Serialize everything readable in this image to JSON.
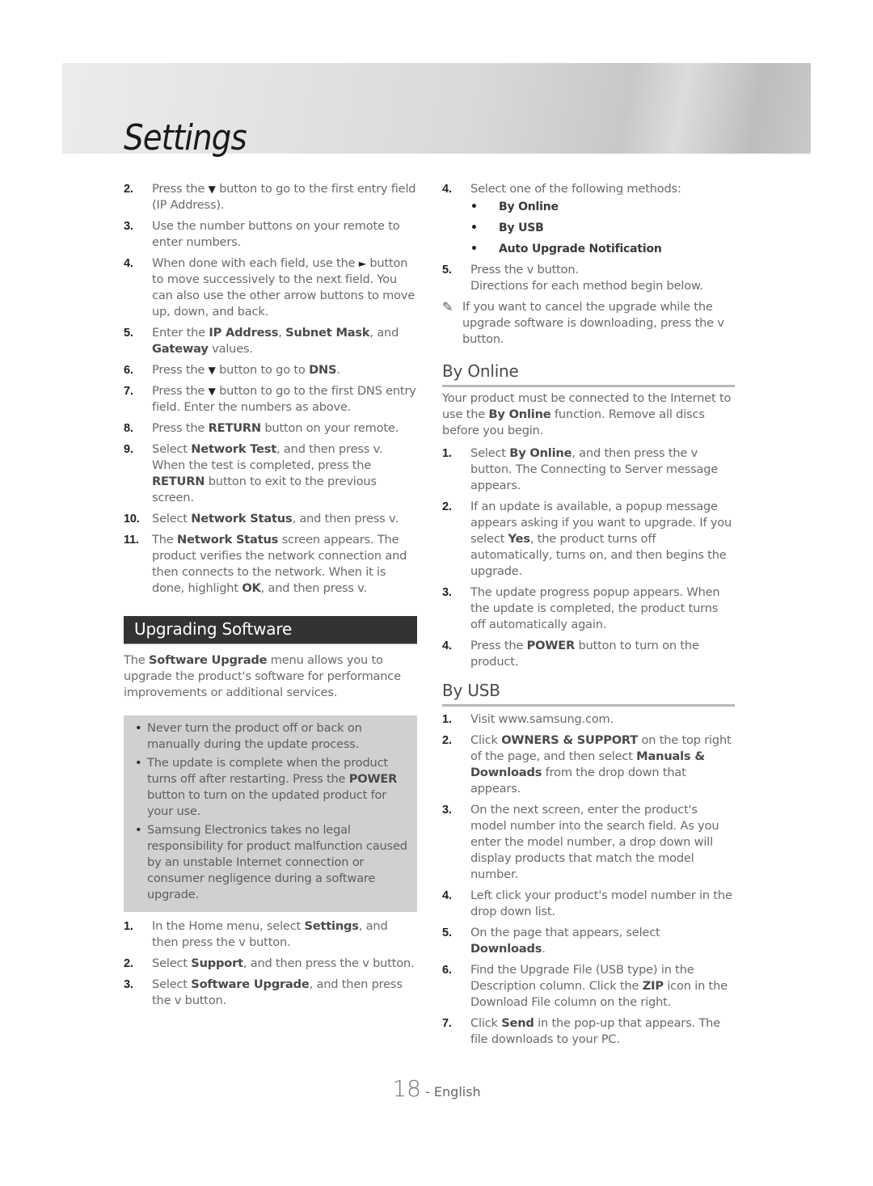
{
  "header": {
    "title": "Settings"
  },
  "left": {
    "steps_top": [
      {
        "num": "2.",
        "parts": [
          {
            "t": "Press the "
          },
          {
            "t": "▼",
            "icon": "down-arrow-icon"
          },
          {
            "t": " button to go to the first entry field (IP Address)."
          }
        ]
      },
      {
        "num": "3.",
        "parts": [
          {
            "t": "Use the number buttons on your remote to enter numbers."
          }
        ]
      },
      {
        "num": "4.",
        "parts": [
          {
            "t": "When done with each field, use the "
          },
          {
            "t": "►",
            "icon": "right-arrow-icon"
          },
          {
            "t": " button to move successively to the next field. You can also use the other arrow buttons to move up, down, and back."
          }
        ]
      },
      {
        "num": "5.",
        "parts": [
          {
            "t": "Enter the "
          },
          {
            "t": "IP Address",
            "b": true
          },
          {
            "t": ", "
          },
          {
            "t": "Subnet Mask",
            "b": true
          },
          {
            "t": ", and "
          },
          {
            "t": "Gateway",
            "b": true
          },
          {
            "t": " values."
          }
        ]
      },
      {
        "num": "6.",
        "parts": [
          {
            "t": "Press the "
          },
          {
            "t": "▼",
            "icon": "down-arrow-icon"
          },
          {
            "t": " button to go to "
          },
          {
            "t": "DNS",
            "b": true
          },
          {
            "t": "."
          }
        ]
      },
      {
        "num": "7.",
        "parts": [
          {
            "t": "Press the "
          },
          {
            "t": "▼",
            "icon": "down-arrow-icon"
          },
          {
            "t": " button to go to the first DNS entry field. Enter the numbers as above."
          }
        ]
      },
      {
        "num": "8.",
        "parts": [
          {
            "t": "Press the "
          },
          {
            "t": "RETURN",
            "b": true
          },
          {
            "t": " button on your remote."
          }
        ]
      },
      {
        "num": "9.",
        "parts": [
          {
            "t": "Select "
          },
          {
            "t": "Network Test",
            "b": true
          },
          {
            "t": ", and then press v. When the test is completed, press the "
          },
          {
            "t": "RETURN",
            "b": true
          },
          {
            "t": " button to exit to the previous screen."
          }
        ]
      },
      {
        "num": "10.",
        "parts": [
          {
            "t": "Select "
          },
          {
            "t": "Network Status",
            "b": true
          },
          {
            "t": ", and then press v."
          }
        ]
      },
      {
        "num": "11.",
        "parts": [
          {
            "t": "The "
          },
          {
            "t": "Network Status",
            "b": true
          },
          {
            "t": " screen appears. The product verifies the network connection and then connects to the network. When it is done, highlight "
          },
          {
            "t": "OK",
            "b": true
          },
          {
            "t": ", and then press v."
          }
        ]
      }
    ],
    "section_title": "Upgrading Software",
    "intro": [
      {
        "t": "The "
      },
      {
        "t": "Software Upgrade",
        "b": true
      },
      {
        "t": " menu allows you to upgrade the product's software for performance improvements or additional services."
      }
    ],
    "notes": [
      [
        {
          "t": "Never turn the product off or back on manually during the update process."
        }
      ],
      [
        {
          "t": "The update is complete when the product turns off after restarting. Press the "
        },
        {
          "t": "POWER",
          "b": true
        },
        {
          "t": " button to turn on the updated product for your use."
        }
      ],
      [
        {
          "t": "Samsung Electronics takes no legal responsibility for product malfunction caused by an unstable Internet connection or consumer negligence during a software upgrade."
        }
      ]
    ],
    "steps_bottom": [
      {
        "num": "1.",
        "parts": [
          {
            "t": "In the Home menu, select "
          },
          {
            "t": "Settings",
            "b": true
          },
          {
            "t": ", and then press the v button."
          }
        ]
      },
      {
        "num": "2.",
        "parts": [
          {
            "t": "Select "
          },
          {
            "t": "Support",
            "b": true
          },
          {
            "t": ", and then press the v button."
          }
        ]
      },
      {
        "num": "3.",
        "parts": [
          {
            "t": "Select "
          },
          {
            "t": "Software Upgrade",
            "b": true
          },
          {
            "t": ", and then press the v button."
          }
        ]
      }
    ]
  },
  "right": {
    "step4": {
      "num": "4.",
      "text": "Select one of the following methods:"
    },
    "methods": [
      "By Online",
      "By USB",
      "Auto Upgrade Notification"
    ],
    "step5": {
      "num": "5.",
      "text": "Press the v button.",
      "text2": "Directions for each method begin below."
    },
    "memo": "If you want to cancel the upgrade while the upgrade software is downloading, press the v button.",
    "by_online": {
      "title": "By Online",
      "intro": [
        {
          "t": "Your product must be connected to the Internet to use the "
        },
        {
          "t": "By Online",
          "b": true
        },
        {
          "t": " function. Remove all discs before you begin."
        }
      ],
      "steps": [
        {
          "num": "1.",
          "parts": [
            {
              "t": "Select "
            },
            {
              "t": "By Online",
              "b": true
            },
            {
              "t": ", and then press the v button. The Connecting to Server message appears."
            }
          ]
        },
        {
          "num": "2.",
          "parts": [
            {
              "t": "If an update is available, a popup message appears asking if you want to upgrade. If you select "
            },
            {
              "t": "Yes",
              "b": true
            },
            {
              "t": ", the product turns off automatically, turns on, and then begins the upgrade."
            }
          ]
        },
        {
          "num": "3.",
          "parts": [
            {
              "t": "The update progress popup appears. When the update is completed, the product turns off automatically again."
            }
          ]
        },
        {
          "num": "4.",
          "parts": [
            {
              "t": "Press the "
            },
            {
              "t": "POWER",
              "b": true
            },
            {
              "t": " button to turn on the product."
            }
          ]
        }
      ]
    },
    "by_usb": {
      "title": "By USB",
      "steps": [
        {
          "num": "1.",
          "parts": [
            {
              "t": "Visit www.samsung.com."
            }
          ]
        },
        {
          "num": "2.",
          "parts": [
            {
              "t": "Click "
            },
            {
              "t": "OWNERS & SUPPORT",
              "b": true
            },
            {
              "t": " on the top right of the page, and then select "
            },
            {
              "t": "Manuals & Downloads",
              "b": true
            },
            {
              "t": " from the drop down that appears."
            }
          ]
        },
        {
          "num": "3.",
          "parts": [
            {
              "t": "On the next screen, enter the product's model number into the search field. As you enter the model number, a drop down will display products that match the model number."
            }
          ]
        },
        {
          "num": "4.",
          "parts": [
            {
              "t": "Left click your product's model number in the drop down list."
            }
          ]
        },
        {
          "num": "5.",
          "parts": [
            {
              "t": "On the page that appears, select "
            },
            {
              "t": "Downloads",
              "b": true
            },
            {
              "t": "."
            }
          ]
        },
        {
          "num": "6.",
          "parts": [
            {
              "t": "Find the Upgrade File (USB type) in the Description column. Click the "
            },
            {
              "t": "ZIP",
              "b": true
            },
            {
              "t": " icon in the Download File column on the right."
            }
          ]
        },
        {
          "num": "7.",
          "parts": [
            {
              "t": "Click "
            },
            {
              "t": "Send",
              "b": true
            },
            {
              "t": " in the pop-up that appears. The file downloads to your PC."
            }
          ]
        }
      ]
    }
  },
  "footer": {
    "page_number": "18",
    "separator": " - ",
    "language": "English"
  }
}
